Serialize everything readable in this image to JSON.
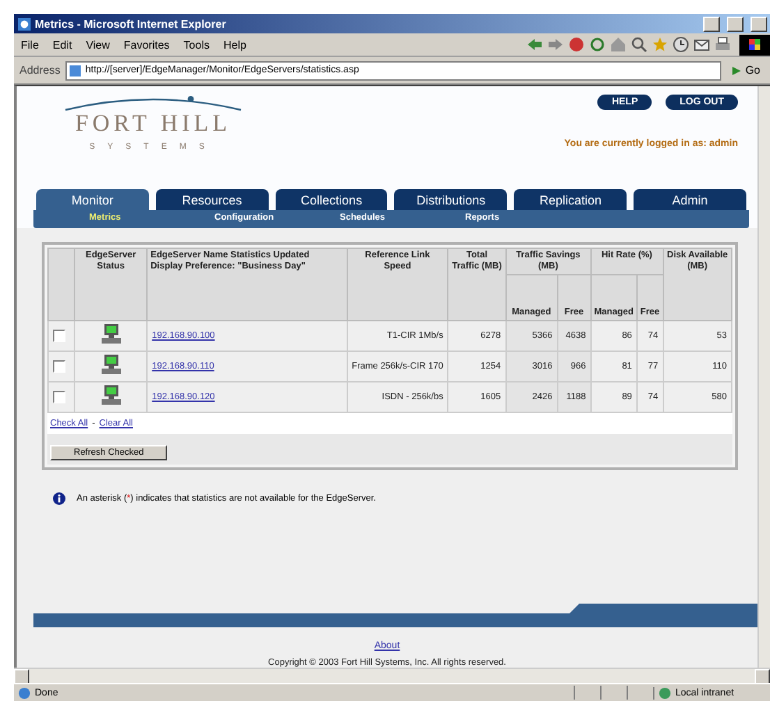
{
  "window": {
    "title": "Metrics - Microsoft Internet Explorer"
  },
  "menu": [
    "File",
    "Edit",
    "View",
    "Favorites",
    "Tools",
    "Help"
  ],
  "address_bar": {
    "label": "Address",
    "url": "http://[server]/EdgeManager/Monitor/EdgeServers/statistics.asp",
    "go": "Go"
  },
  "header": {
    "logo_name": "FORT HILL",
    "logo_tagline": "SYSTEMS",
    "buttons": [
      "HELP",
      "LOG OUT"
    ],
    "login_status": "You are currently logged in as: admin"
  },
  "tabs": [
    {
      "label": "Monitor",
      "selected": true
    },
    {
      "label": "Resources",
      "selected": false
    },
    {
      "label": "Collections",
      "selected": false
    },
    {
      "label": "Distributions",
      "selected": false
    },
    {
      "label": "Replication",
      "selected": false
    },
    {
      "label": "Admin",
      "selected": false
    }
  ],
  "subtabs": [
    {
      "label": "Metrics",
      "selected": true
    },
    {
      "label": "Configuration",
      "selected": false
    },
    {
      "label": "Schedules",
      "selected": false
    },
    {
      "label": "Reports",
      "selected": false
    }
  ],
  "table": {
    "columns": [
      {
        "label": "EdgeServer Status"
      },
      {
        "label": "EdgeServer Name Statistics Updated Display Preference: \"Business Day\""
      },
      {
        "label": "Reference Link Speed"
      },
      {
        "label": "Total Traffic (MB)"
      },
      {
        "label": "Traffic Savings (MB)",
        "sub": [
          "Managed",
          "Free"
        ]
      },
      {
        "label": "Hit Rate (%)",
        "sub": [
          "Managed",
          "Free"
        ]
      },
      {
        "label": "Disk Available (MB)"
      }
    ],
    "rows": [
      {
        "checked": false,
        "name": "192.168.90.100",
        "link_speed": "T1-CIR 1Mb/s",
        "total": "6278",
        "savings_managed": "5366",
        "savings_free": "4638",
        "hit_managed": "86",
        "hit_free": "74",
        "disk": "53"
      },
      {
        "checked": false,
        "name": "192.168.90.110",
        "link_speed": "Frame 256k/s-CIR 170",
        "total": "1254",
        "savings_managed": "3016",
        "savings_free": "966",
        "hit_managed": "81",
        "hit_free": "77",
        "disk": "110"
      },
      {
        "checked": false,
        "name": "192.168.90.120",
        "link_speed": "ISDN - 256k/bs",
        "total": "1605",
        "savings_managed": "2426",
        "savings_free": "1188",
        "hit_managed": "89",
        "hit_free": "74",
        "disk": "580"
      }
    ]
  },
  "selection_links": {
    "check_all": "Check All",
    "separator": "-",
    "clear_all": "Clear All"
  },
  "refresh_button": "Refresh Checked",
  "note": {
    "before": "An asterisk (",
    "mark": "*",
    "after": ") indicates that statistics are not available for the EdgeServer."
  },
  "footer": {
    "link": "About",
    "copyright": "Copyright © 2003 Fort Hill Systems, Inc. All rights reserved."
  },
  "status_bar": {
    "text": "Done",
    "zone": "Local intranet"
  }
}
